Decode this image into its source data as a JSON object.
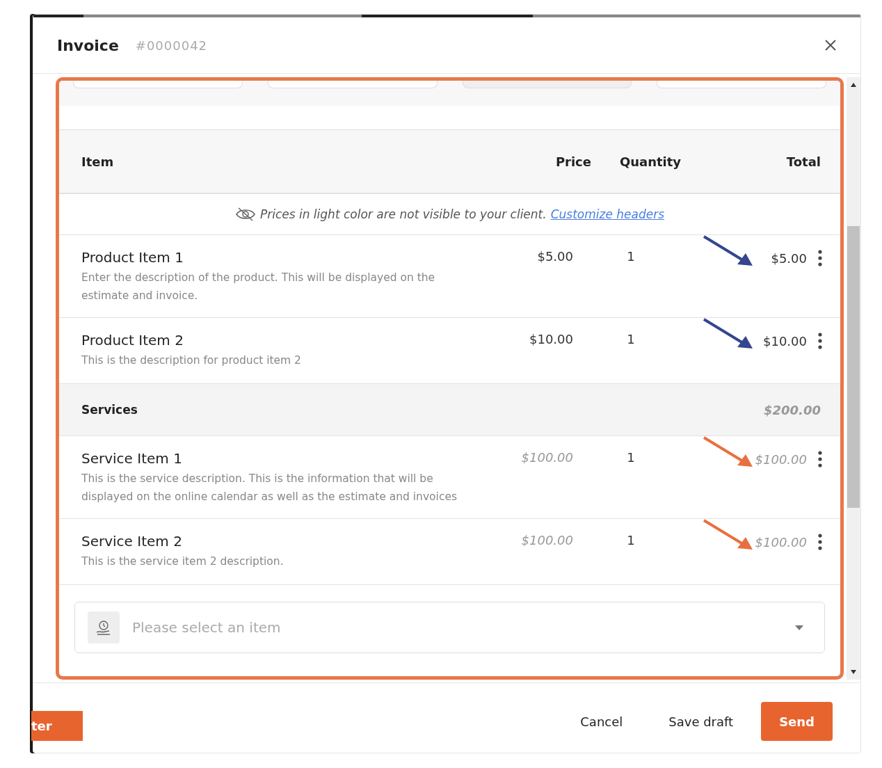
{
  "dialog": {
    "title": "Invoice",
    "number": "#0000042"
  },
  "table": {
    "columns": [
      "Item",
      "Price",
      "Quantity",
      "Total"
    ],
    "notice": {
      "text": "Prices in light color are not visible to your client.",
      "link": "Customize headers"
    },
    "sections": [
      {
        "kind": "items",
        "items": [
          {
            "name": "Product Item 1",
            "description": "Enter the description of the product. This will be displayed on the estimate and invoice.",
            "price": "$5.00",
            "quantity": "1",
            "total": "$5.00",
            "visible_to_client": true,
            "color": "#33468f"
          },
          {
            "name": "Product Item 2",
            "description": "This is the description for product item 2",
            "price": "$10.00",
            "quantity": "1",
            "total": "$10.00",
            "visible_to_client": true,
            "color": "#33468f"
          }
        ]
      },
      {
        "kind": "group",
        "name": "Services",
        "total": "$200.00",
        "visible_to_client": false,
        "items": [
          {
            "name": "Service Item 1",
            "description": "This is the service description. This is the information that will be displayed on the online calendar as well as the estimate and invoices",
            "price": "$100.00",
            "quantity": "1",
            "total": "$100.00",
            "visible_to_client": false,
            "color": "#e8703f"
          },
          {
            "name": "Service Item 2",
            "description": "This is the service item 2 description.",
            "price": "$100.00",
            "quantity": "1",
            "total": "$100.00",
            "visible_to_client": false,
            "color": "#e8703f"
          }
        ]
      }
    ]
  },
  "item_select": {
    "placeholder": "Please select an item"
  },
  "buttons": [
    {
      "label": "Cancel",
      "kind": "plain"
    },
    {
      "label": "Save draft",
      "kind": "plain"
    },
    {
      "label": "Send",
      "kind": "primary"
    }
  ],
  "background_button": {
    "label": "ter"
  }
}
